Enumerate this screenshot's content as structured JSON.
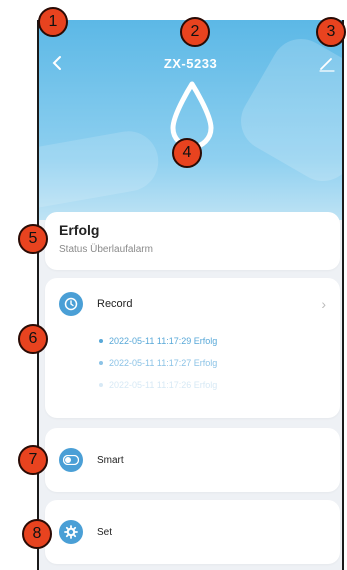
{
  "header": {
    "title": "ZX-5233",
    "back_icon": "chevron-left-icon",
    "edit_icon": "pencil-icon",
    "device_icon": "water-drop-icon"
  },
  "status": {
    "value": "Erfolg",
    "label": "Status Überlaufalarm"
  },
  "record": {
    "label": "Record",
    "icon": "clock-icon",
    "entries": [
      "2022-05-11 11:17:29 Erfolg",
      "2022-05-11 11:17:27 Erfolg",
      "2022-05-11 11:17:26 Erfolg"
    ]
  },
  "smart": {
    "label": "Smart",
    "icon": "toggle-icon"
  },
  "settings": {
    "label": "Set",
    "icon": "gear-icon"
  },
  "annotations": [
    "1",
    "2",
    "3",
    "4",
    "5",
    "6",
    "7",
    "8"
  ],
  "colors": {
    "header_blue": "#5cb8e6",
    "icon_blue": "#4a9fd6",
    "badge_red": "#e8431f"
  }
}
